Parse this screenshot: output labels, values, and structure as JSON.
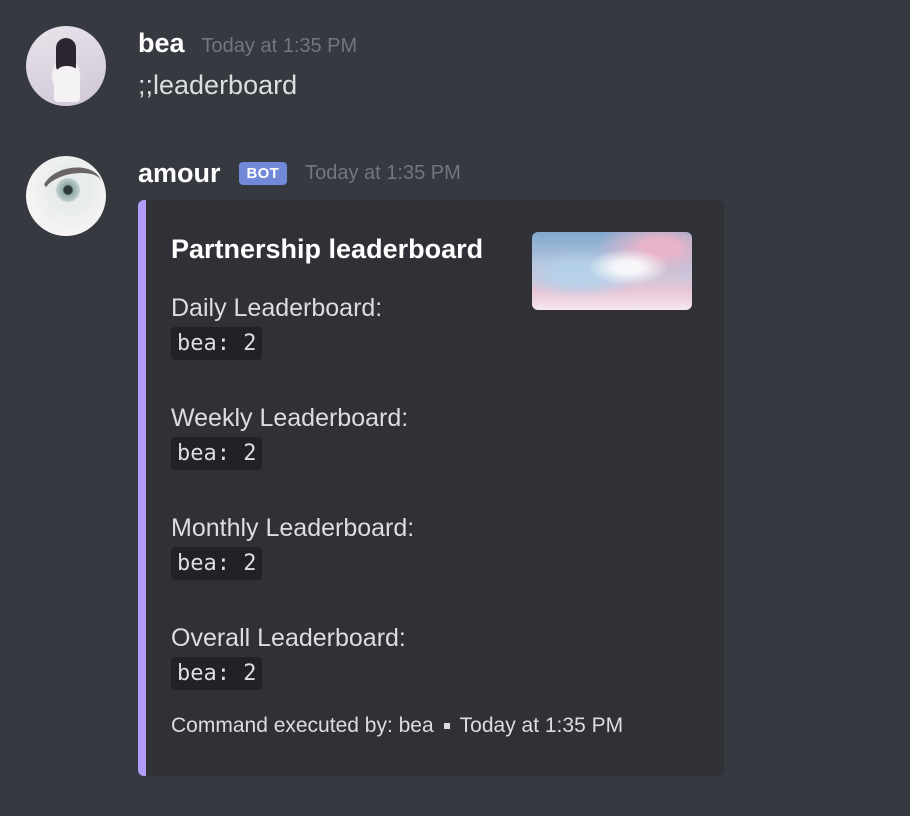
{
  "messages": [
    {
      "username": "bea",
      "timestamp": "Today at 1:35 PM",
      "content": ";;leaderboard"
    },
    {
      "username": "amour",
      "bot_tag": "BOT",
      "timestamp": "Today at 1:35 PM",
      "embed": {
        "accent_color": "#b09cf7",
        "title": "Partnership leaderboard",
        "fields": [
          {
            "name": "Daily Leaderboard:",
            "value": "bea: 2"
          },
          {
            "name": "Weekly Leaderboard:",
            "value": "bea: 2"
          },
          {
            "name": "Monthly Leaderboard:",
            "value": "bea: 2"
          },
          {
            "name": "Overall Leaderboard:",
            "value": "bea: 2"
          }
        ],
        "footer_text": "Command executed by: bea",
        "footer_timestamp": "Today at 1:35 PM"
      }
    }
  ]
}
